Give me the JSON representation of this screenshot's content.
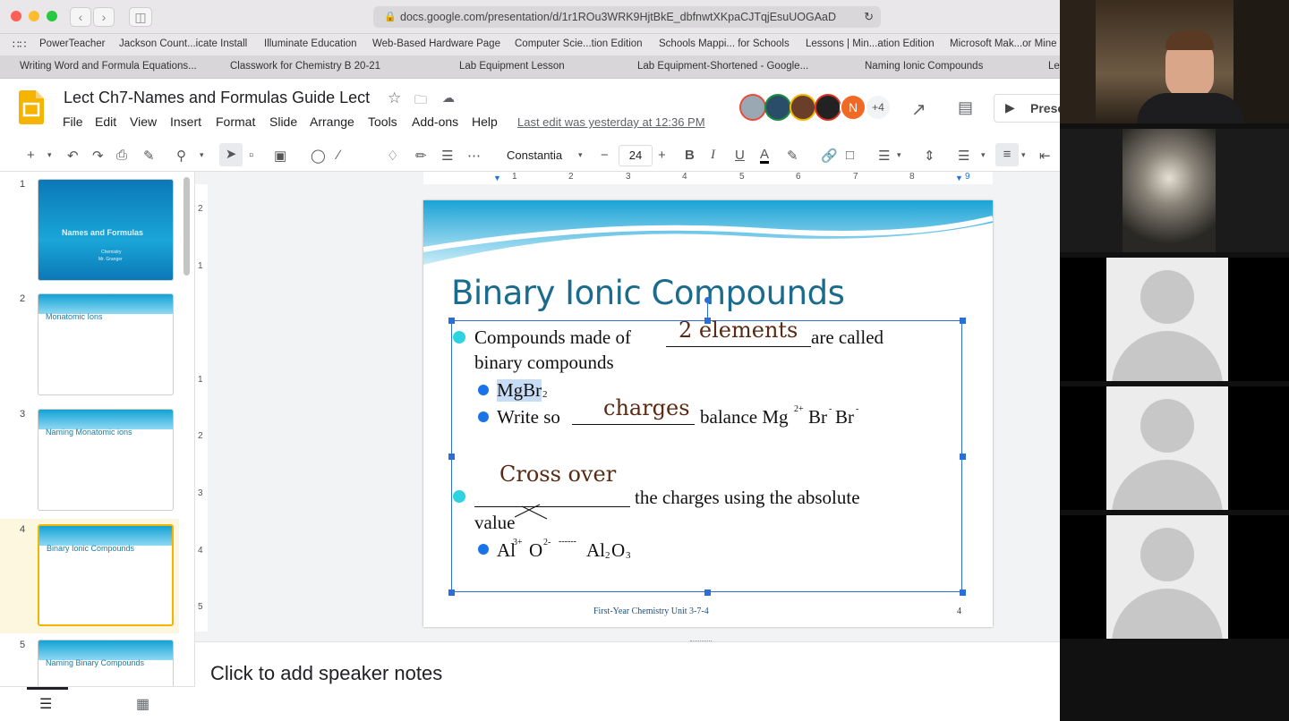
{
  "browser": {
    "url": "docs.google.com/presentation/d/1r1ROu3WRK9HjtBkE_dbfnwtXKpaCJTqjEsuUOGAaD",
    "bookmarks": [
      "PowerTeacher",
      "Jackson Count...icate Install",
      "Illuminate Education",
      "Web-Based Hardware Page",
      "Computer Scie...tion Edition",
      "Schools Mappi... for Schools",
      "Lessons | Min...ation Edition",
      "Microsoft Mak...or Mine"
    ],
    "tabs": [
      "Writing Word and Formula Equations...",
      "Classwork for Chemistry B 20-21",
      "Lab Equipment Lesson",
      "Lab Equipment-Shortened - Google...",
      "Naming Ionic Compounds",
      "Le"
    ]
  },
  "app": {
    "doc_title": "Lect Ch7-Names and Formulas Guide Lect",
    "menus": [
      "File",
      "Edit",
      "View",
      "Insert",
      "Format",
      "Slide",
      "Arrange",
      "Tools",
      "Add-ons",
      "Help"
    ],
    "last_edit": "Last edit was yesterday at 12:36 PM",
    "collab_extra": "+4",
    "avatar_letter": "N",
    "present_label": "Prese"
  },
  "toolbar": {
    "font": "Constantia",
    "font_size": "24"
  },
  "ruler": {
    "marks": [
      "1",
      "2",
      "3",
      "4",
      "5",
      "6",
      "7",
      "8",
      "9"
    ],
    "vmarks": [
      "2",
      "1",
      "1",
      "2",
      "3",
      "4",
      "5"
    ]
  },
  "filmstrip": {
    "slides": [
      {
        "num": "1",
        "title": "Names and Formulas",
        "sub": "Chemistry",
        "sub2": "Mr. Granger"
      },
      {
        "num": "2",
        "title": "Monatomic Ions"
      },
      {
        "num": "3",
        "title": "Naming Monatomic ions"
      },
      {
        "num": "4",
        "title": "Binary Ionic Compounds"
      },
      {
        "num": "5",
        "title": "Naming Binary Compounds"
      }
    ]
  },
  "slide": {
    "title": "Binary Ionic Compounds",
    "b1_pre": "Compounds made of",
    "b1_hand": "2 elements",
    "b1_post": "are called",
    "b1_line2": "binary compounds",
    "sub1": "MgBr",
    "sub1_sub": "2",
    "sub2_pre": "Write so",
    "sub2_hand": "charges",
    "sub2_post": "balance Mg",
    "sub2_sup": "2+",
    "sub2_br1": "Br",
    "sub2_br2": "Br",
    "sub2_brsup": "-",
    "b2_hand": "Cross over",
    "b2_post": "the charges using the absolute",
    "b2_line2": "value",
    "sub3_al": "Al",
    "sub3_alsup": "3+",
    "sub3_o": "O",
    "sub3_osup": "2-",
    "sub3_arrow": "------",
    "sub3_res_al": "Al",
    "sub3_res_sub1": "2",
    "sub3_res_o": "O",
    "sub3_res_sub2": "3",
    "footer": "First-Year Chemistry Unit 3-7-4",
    "page": "4"
  },
  "notes": {
    "placeholder": "Click to add speaker notes"
  },
  "colors": {
    "accent": "#1a73e8",
    "title": "#1a6b8c",
    "selection": "#2b6fd6"
  }
}
